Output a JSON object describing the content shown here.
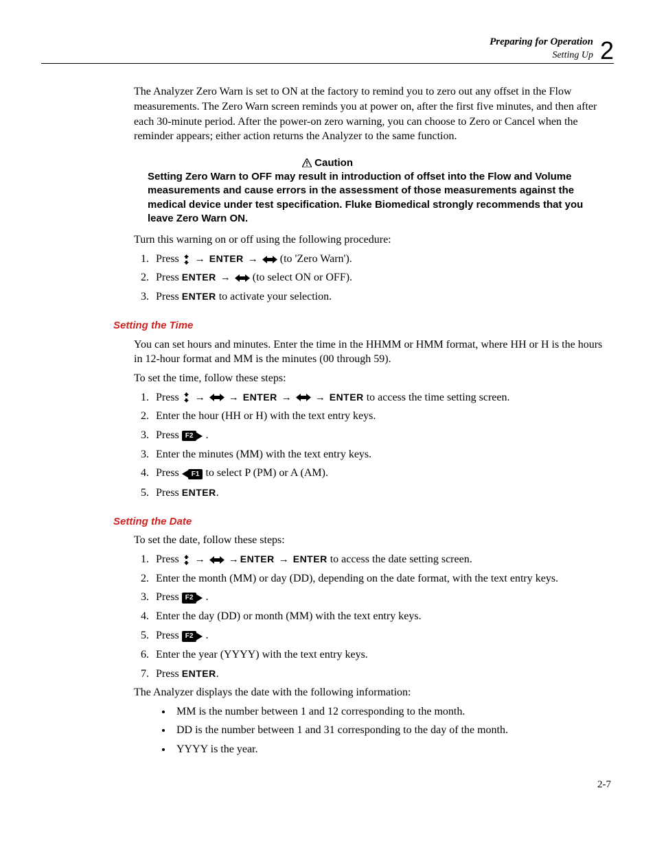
{
  "header": {
    "line1": "Preparing for Operation",
    "line2": "Setting Up",
    "chapter": "2"
  },
  "intro_para": "The Analyzer Zero Warn is set to ON at the factory to remind you to zero out any offset in the Flow measurements. The Zero Warn screen reminds you at power on, after the first five minutes, and then after each 30-minute period. After the power-on zero warning, you can choose to Zero or Cancel when the reminder appears; either action returns the Analyzer to the same function.",
  "caution": {
    "heading": "Caution",
    "body": "Setting Zero Warn to OFF may result in introduction of offset into the Flow and Volume measurements and cause errors in the assessment of those measurements against the medical device under test specification. Fluke Biomedical strongly recommends that you leave Zero Warn ON."
  },
  "turn_warning": "Turn this warning on or off using the following procedure:",
  "zero_steps": {
    "s1_prefix": "Press ",
    "s1_suffix": " (to 'Zero Warn').",
    "s2_prefix": "Press ",
    "s2_suffix": "  (to select ON or OFF).",
    "s3_prefix": "Press ",
    "s3_suffix": "  to activate your selection."
  },
  "time": {
    "heading": "Setting the Time",
    "intro": "You can set hours and minutes. Enter the time in the HHMM or HMM format, where HH or H is the hours in 12-hour format and MM is the minutes (00 through 59).",
    "lead": "To set the time, follow these steps:",
    "s1_prefix": "Press ",
    "s1_suffix": "  to access the time setting screen.",
    "s2": "Enter the hour (HH or H) with the text entry keys.",
    "s3_prefix": "Press ",
    "s3_suffix": " .",
    "s3b": "Enter the minutes (MM) with the text entry keys.",
    "s4_prefix": "Press ",
    "s4_suffix": " to select P (PM) or A (AM).",
    "s5_prefix": "Press ",
    "s5_suffix": "."
  },
  "date": {
    "heading": "Setting the Date",
    "lead": "To set the date, follow these steps:",
    "s1_prefix": "Press ",
    "s1_suffix": " to access the date setting screen.",
    "s2": "Enter the month (MM) or day (DD), depending on the date format, with the text entry keys.",
    "s3_prefix": "Press ",
    "s3_suffix": " .",
    "s4": "Enter the day (DD) or month (MM) with the text entry keys.",
    "s5_prefix": "Press ",
    "s5_suffix": " .",
    "s6": "Enter the year (YYYY) with the text entry keys.",
    "s7_prefix": "Press ",
    "s7_suffix": ".",
    "tail": "The Analyzer displays the date with the following information:",
    "b1": "MM is the number between 1 and 12 corresponding to the month.",
    "b2": "DD is the number between 1 and 31 corresponding to the day of the month.",
    "b3": "YYYY is the year."
  },
  "keys": {
    "enter": "ENTER",
    "f1": "F1",
    "f2": "F2"
  },
  "page_num": "2-7"
}
